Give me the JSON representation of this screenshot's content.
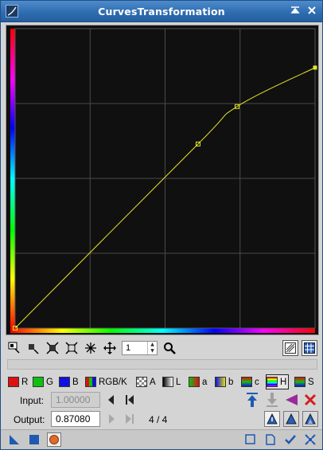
{
  "window": {
    "title": "CurvesTransformation"
  },
  "toolbar": {
    "zoom_value": "1"
  },
  "channels": [
    {
      "key": "r",
      "label": "R",
      "color": "#e01010"
    },
    {
      "key": "g",
      "label": "G",
      "color": "#10c010"
    },
    {
      "key": "b",
      "label": "B",
      "color": "#1010e0"
    },
    {
      "key": "rgbk",
      "label": "RGB/K"
    },
    {
      "key": "a",
      "label": "A"
    },
    {
      "key": "l",
      "label": "L"
    },
    {
      "key": "a2",
      "label": "a"
    },
    {
      "key": "b2",
      "label": "b"
    },
    {
      "key": "c",
      "label": "c"
    },
    {
      "key": "h",
      "label": "H",
      "selected": true
    },
    {
      "key": "s",
      "label": "S"
    }
  ],
  "input": {
    "label": "Input:",
    "value": "1.00000"
  },
  "output": {
    "label": "Output:",
    "value": "0.87080"
  },
  "counter": "4 / 4",
  "curve": {
    "color": "#e6e628",
    "points": [
      [
        0,
        0
      ],
      [
        0.61,
        0.615
      ],
      [
        0.74,
        0.74
      ],
      [
        1.0,
        0.87
      ]
    ]
  }
}
